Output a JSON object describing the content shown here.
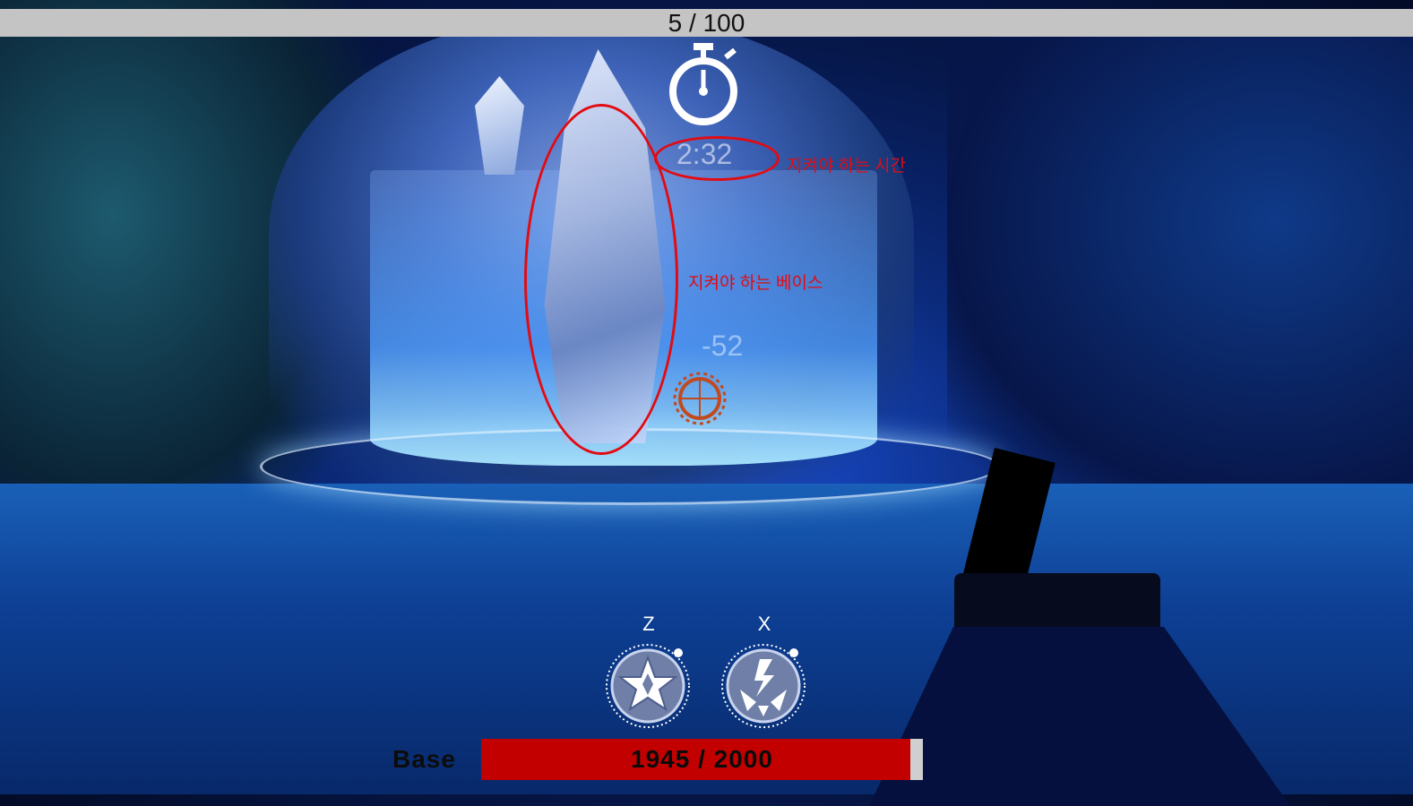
{
  "hud": {
    "wave_text": "5 / 100",
    "timer_text": "2:32",
    "floating_damage": "-52",
    "annotations": {
      "time_label": "지켜야 하는 시간",
      "base_label": "지켜야 하는 베이스"
    },
    "skills": [
      {
        "key": "Z",
        "icon": "star-burst-icon"
      },
      {
        "key": "X",
        "icon": "lightning-shatter-icon"
      }
    ],
    "base_health": {
      "label": "Base",
      "current": 1945,
      "max": 2000,
      "text": "1945 / 2000",
      "fraction": 0.9725
    },
    "colors": {
      "hp_fill": "#c20000",
      "hp_track": "#cfcfcf",
      "annotation": "#e20b12",
      "wave_bar": "#c4c4c4"
    }
  }
}
